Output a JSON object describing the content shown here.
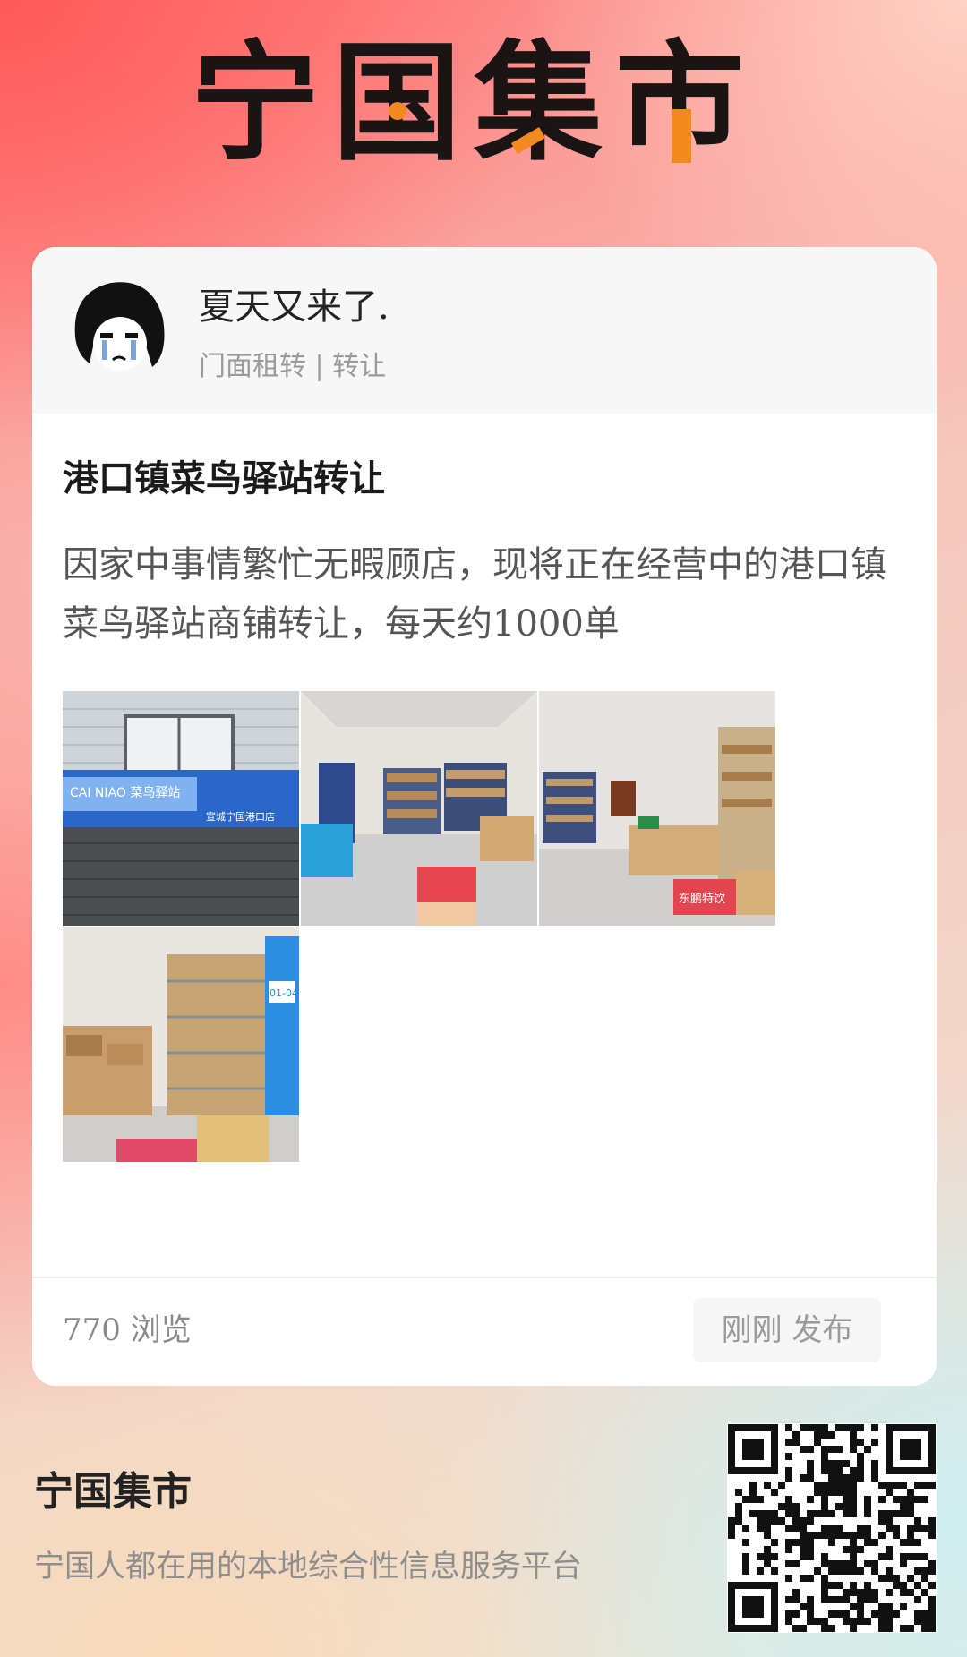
{
  "brand": {
    "logo_text": "宁国集市",
    "colors": {
      "dark": "#1b1414",
      "accent": "#f28a1f"
    }
  },
  "post": {
    "author": "夏天又来了.",
    "category": "门面租转 | 转让",
    "title": "港口镇菜鸟驿站转让",
    "body": "因家中事情繁忙无暇顾店，现将正在经营中的港口镇菜鸟驿站商铺转让，每天约1000单",
    "photos": [
      {
        "icon": "storefront-photo",
        "sign_text": "CAI NIAO 菜鸟驿站",
        "branch_text": "宣城宁国港口店"
      },
      {
        "icon": "warehouse-photo"
      },
      {
        "icon": "warehouse-photo",
        "box_label": "东鹏特饮"
      },
      {
        "icon": "shelves-photo",
        "shelf_tag": "01-04"
      }
    ],
    "views": "770 浏览",
    "published": "刚刚 发布"
  },
  "footer": {
    "name": "宁国集市",
    "slogan": "宁国人都在用的本地综合性信息服务平台",
    "qr_icon": "qr-code-icon"
  }
}
